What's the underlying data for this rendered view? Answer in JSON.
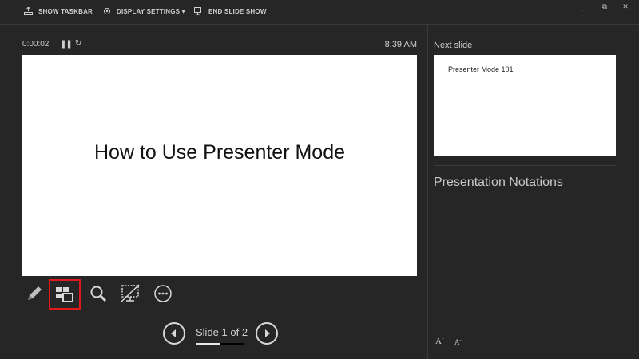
{
  "toolbar": {
    "show_taskbar": "SHOW TASKBAR",
    "display_settings": "DISPLAY SETTINGS ▾",
    "end_slide_show": "END SLIDE SHOW"
  },
  "window": {
    "minimize": "_",
    "restore": "⧉",
    "close": "✕"
  },
  "timer": {
    "elapsed": "0:00:02",
    "pause_glyph": "❚❚",
    "restart_glyph": "↻",
    "clock": "8:39 AM"
  },
  "current_slide": {
    "title": "How to Use Presenter Mode"
  },
  "navigation": {
    "counter": "Slide 1 of 2",
    "progress_fraction": 0.5
  },
  "next_slide": {
    "label": "Next slide",
    "title": "Presenter Mode 101"
  },
  "notes": {
    "title": "Presentation Notations"
  },
  "font_controls": {
    "increase": "A",
    "increase_sup": "+",
    "decrease": "A",
    "decrease_sup": "-"
  },
  "colors": {
    "background": "#262626",
    "highlight": "#e01a1a"
  }
}
